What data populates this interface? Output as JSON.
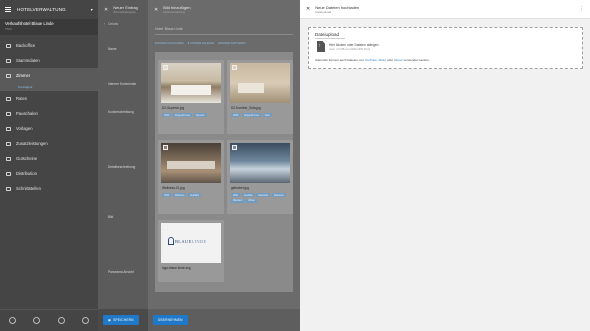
{
  "sidebar": {
    "app_title": "HOTELVERWALTUNG",
    "hotel_name": "Verkaufshotel Blaue Linde",
    "hotel_sub": "TSCI",
    "items": [
      {
        "label": "Backoffice",
        "icon": "briefcase-icon"
      },
      {
        "label": "Stammdaten",
        "icon": "database-icon"
      },
      {
        "label": "Zimmer",
        "icon": "bed-icon"
      },
      {
        "label": "Raten",
        "icon": "rates-icon"
      },
      {
        "label": "Pauschalen",
        "icon": "package-icon"
      },
      {
        "label": "Vorlagen",
        "icon": "template-icon"
      },
      {
        "label": "Zusatzleistungen",
        "icon": "extras-icon"
      },
      {
        "label": "Gutscheine",
        "icon": "voucher-icon"
      },
      {
        "label": "Distribution",
        "icon": "distribution-icon"
      },
      {
        "label": "Schnittstellen",
        "icon": "interfaces-icon"
      }
    ],
    "sub_item": "Kontingent"
  },
  "panel1": {
    "title": "Neuer Eintrag",
    "subtitle": "Zimmerkategorie",
    "tab": "Details",
    "labels": [
      "Name",
      "Interner Kommentar",
      "Kurzbeschreibung",
      "Detailbeschreibung",
      "Bild",
      "Panorama Ansicht"
    ],
    "save_label": "SPEICHERN"
  },
  "panel2": {
    "title": "Bild hinzufügen",
    "subtitle": "Dateiverwaltung",
    "search_text": "Hotel: Blaue Linde",
    "filters": [
      "■ BILDER HOCHLADEN",
      "■ ORDNER ANLEGEN",
      "■ BILDER SORTIEREN"
    ],
    "cards": [
      {
        "file": "D2-Superior.jpg",
        "tags": [
          "2020",
          "Doppelzimmer",
          "Superior"
        ]
      },
      {
        "file": "D2-Komfort_Sofa.jpg",
        "tags": [
          "2020",
          "Doppelzimmer",
          "Sofa"
        ]
      },
      {
        "file": "Wellness-01.jpg",
        "tags": [
          "2021",
          "Wellness",
          "Ausblick"
        ]
      },
      {
        "file": "gletscher.jpg",
        "tags": [
          "2021",
          "Ausblick",
          "Gletscher",
          "Reisezeit",
          "Wandern",
          "Winter"
        ]
      },
      {
        "file": "logo-blaue-linde.svg",
        "tags": []
      }
    ],
    "logo_text_1": "BLAUE",
    "logo_text_2": "LINDE",
    "apply_label": "ÜBERNEHMEN"
  },
  "panel3": {
    "title": "Neue Dateien hochladen",
    "subtitle": "Dateiupload",
    "more_icon": "⋮",
    "upload_title": "Dateiupload",
    "drop_text": "Hier klicken oder Dateien ablegen",
    "limit_text": "(max. 2,0 MB und 1600x1600 Pixel)",
    "alt_prefix": "Alternativ können auch Dateien von",
    "alt_youtube": "YouTube",
    "alt_sep1": ",",
    "alt_flickr": "Flickr",
    "alt_or": "oder",
    "alt_vimeo": "Vimeo",
    "alt_suffix": "verwendet werden."
  }
}
